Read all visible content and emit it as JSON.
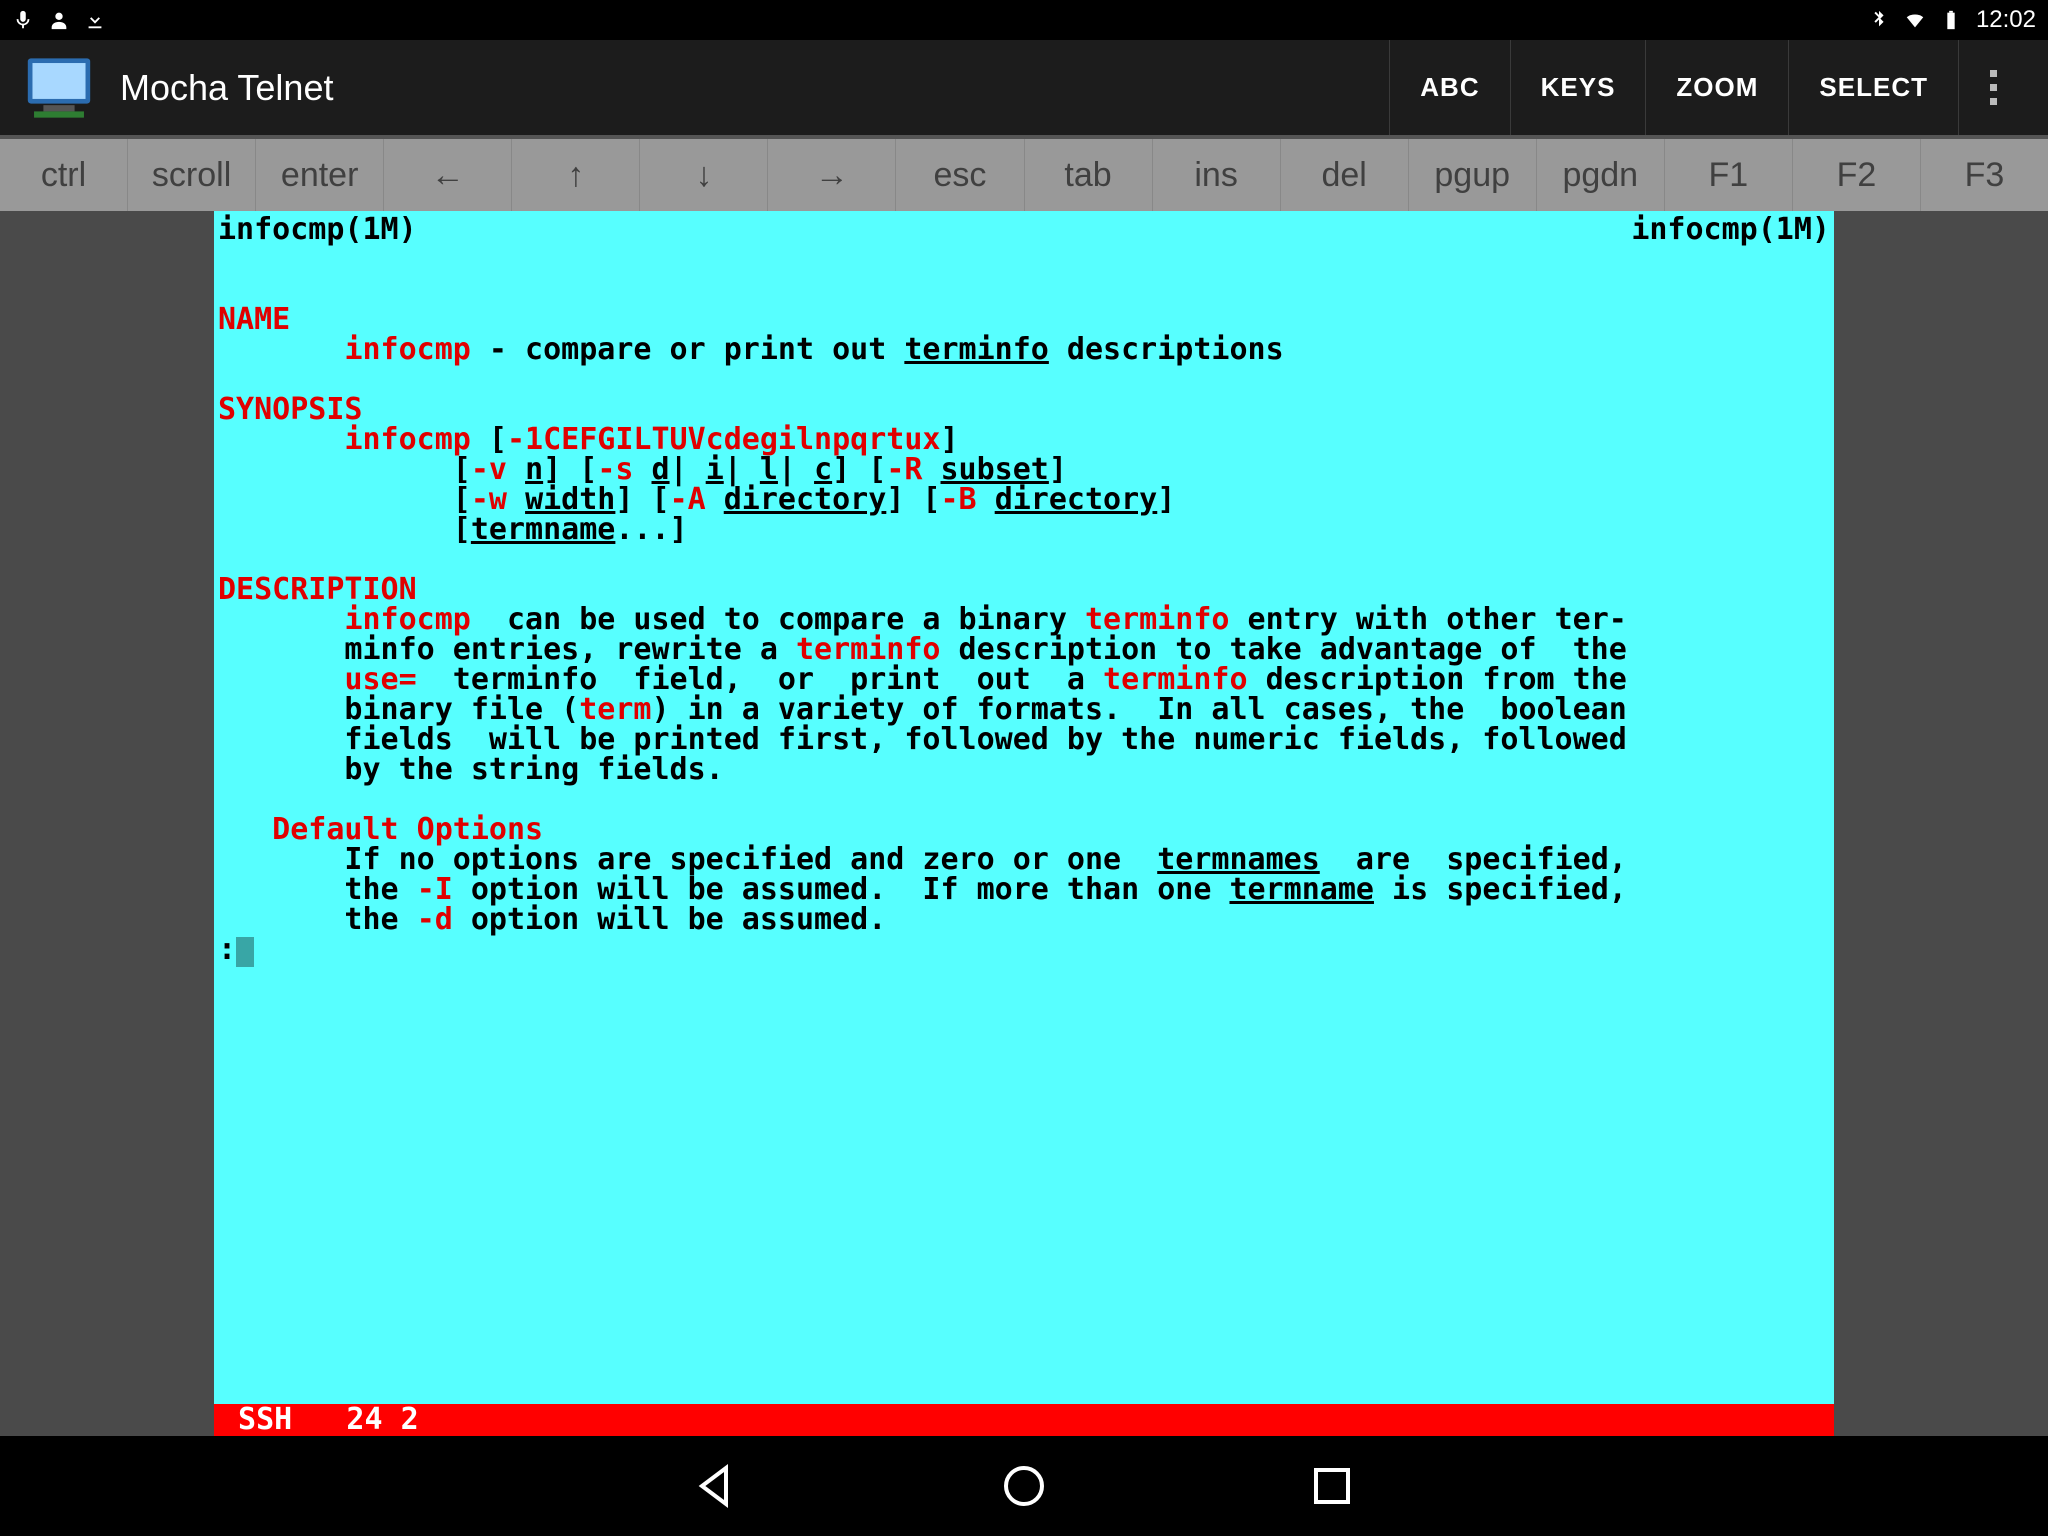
{
  "status": {
    "time": "12:02"
  },
  "app": {
    "title": "Mocha Telnet",
    "actions": {
      "abc": "ABC",
      "keys": "KEYS",
      "zoom": "ZOOM",
      "select": "SELECT"
    }
  },
  "keys": {
    "ctrl": "ctrl",
    "scroll": "scroll",
    "enter": "enter",
    "left": "←",
    "up": "↑",
    "down": "↓",
    "right": "→",
    "esc": "esc",
    "tab": "tab",
    "ins": "ins",
    "del": "del",
    "pgup": "pgup",
    "pgdn": "pgdn",
    "f1": "F1",
    "f2": "F2",
    "f3": "F3"
  },
  "man": {
    "header_left": "infocmp(1M)",
    "header_right": "infocmp(1M)",
    "name_hdr": "NAME",
    "name_cmd": "infocmp",
    "name_sep": " - compare or print out ",
    "name_ul": "terminfo",
    "name_tail": " descriptions",
    "syn_hdr": "SYNOPSIS",
    "syn_l1a": "       ",
    "syn_l1b": "infocmp",
    "syn_l1c": " [",
    "syn_l1d": "-1CEFGILTUVcdegilnpqrtux",
    "syn_l1e": "]",
    "syn_l2a": "             [",
    "syn_l2b": "-v",
    "syn_l2c": " ",
    "syn_l2d": "n",
    "syn_l2e": "] [",
    "syn_l2f": "-s",
    "syn_l2g": " ",
    "syn_l2h": "d",
    "syn_l2i": "| ",
    "syn_l2j": "i",
    "syn_l2k": "| ",
    "syn_l2l": "l",
    "syn_l2m": "| ",
    "syn_l2n": "c",
    "syn_l2o": "] [",
    "syn_l2p": "-R",
    "syn_l2q": " ",
    "syn_l2r": "subset",
    "syn_l2s": "]",
    "syn_l3a": "             [",
    "syn_l3b": "-w",
    "syn_l3c": " ",
    "syn_l3d": "width",
    "syn_l3e": "] [",
    "syn_l3f": "-A",
    "syn_l3g": " ",
    "syn_l3h": "directory",
    "syn_l3i": "] [",
    "syn_l3j": "-B",
    "syn_l3k": " ",
    "syn_l3l": "directory",
    "syn_l3m": "]",
    "syn_l4a": "             [",
    "syn_l4b": "termname",
    "syn_l4c": "...]",
    "desc_hdr": "DESCRIPTION",
    "d1a": "       ",
    "d1b": "infocmp",
    "d1c": "  can be used to compare a binary ",
    "d1d": "terminfo",
    "d1e": " entry with other ter-",
    "d2a": "       minfo entries, rewrite a ",
    "d2b": "terminfo",
    "d2c": " description to take advantage of  the",
    "d3a": "       ",
    "d3b": "use=",
    "d3c": "  terminfo  field,  or  print  out  a ",
    "d3d": "terminfo",
    "d3e": " description from the",
    "d4": "       binary file (",
    "d4b": "term",
    "d4c": ") in a variety of formats.  In all cases, the  boolean",
    "d5": "       fields  will be printed first, followed by the numeric fields, followed",
    "d6": "       by the string fields.",
    "def_hdr": "   Default Options",
    "do1a": "       If no options are specified and zero or one  ",
    "do1b": "termnames",
    "do1c": "  are  specified,",
    "do2a": "       the ",
    "do2b": "-I",
    "do2c": " option will be assumed.  If more than one ",
    "do2d": "termname",
    "do2e": " is specified,",
    "do3a": "       the ",
    "do3b": "-d",
    "do3c": " option will be assumed.",
    "prompt": ":",
    "status": " SSH   24 2"
  }
}
